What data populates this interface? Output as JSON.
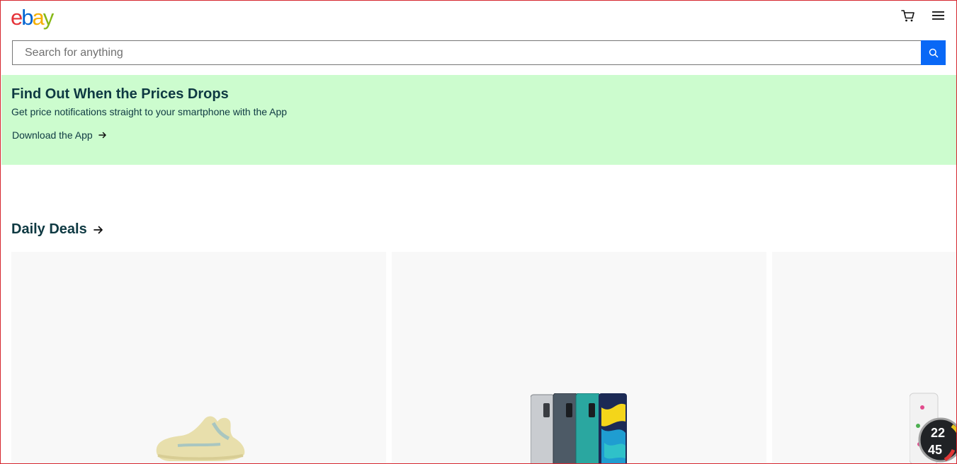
{
  "header": {
    "logo": {
      "letters": [
        "e",
        "b",
        "a",
        "y"
      ],
      "colors": [
        "#e53238",
        "#0064d2",
        "#f5af02",
        "#86b817"
      ]
    },
    "cart_icon": "cart-icon",
    "menu_icon": "hamburger-menu-icon"
  },
  "search": {
    "placeholder": "Search for anything",
    "value": "",
    "button_icon": "search-icon",
    "button_color": "#0968f6"
  },
  "banner": {
    "background": "#ccfcce",
    "title": "Find Out When the Prices Drops",
    "subtitle": "Get price notifications straight to your smartphone with the App",
    "link_label": "Download the App",
    "link_icon": "arrow-right-icon"
  },
  "daily_deals": {
    "heading": "Daily Deals",
    "heading_icon": "arrow-right-icon",
    "items": [
      {
        "image": "sneaker-image"
      },
      {
        "image": "smartphones-image"
      },
      {
        "image": "smartwatch-image"
      }
    ]
  },
  "colors": {
    "text_dark": "#0e3942",
    "card_bg": "#f8f8f8",
    "frame_border": "#d6262f"
  }
}
